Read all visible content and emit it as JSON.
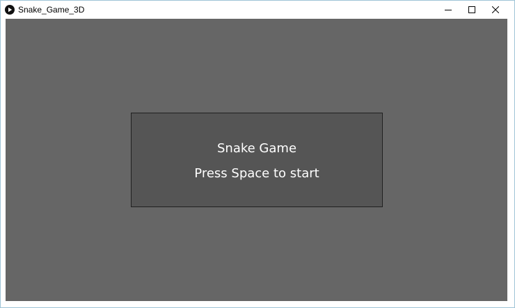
{
  "window": {
    "title": "Snake_Game_3D",
    "icon": "play-circle-icon",
    "controls": {
      "minimize": "minimize-icon",
      "maximize": "maximize-icon",
      "close": "close-icon"
    }
  },
  "game": {
    "background_color": "#666666",
    "panel_color": "#555555",
    "title": "Snake Game",
    "prompt": "Press Space to start"
  }
}
